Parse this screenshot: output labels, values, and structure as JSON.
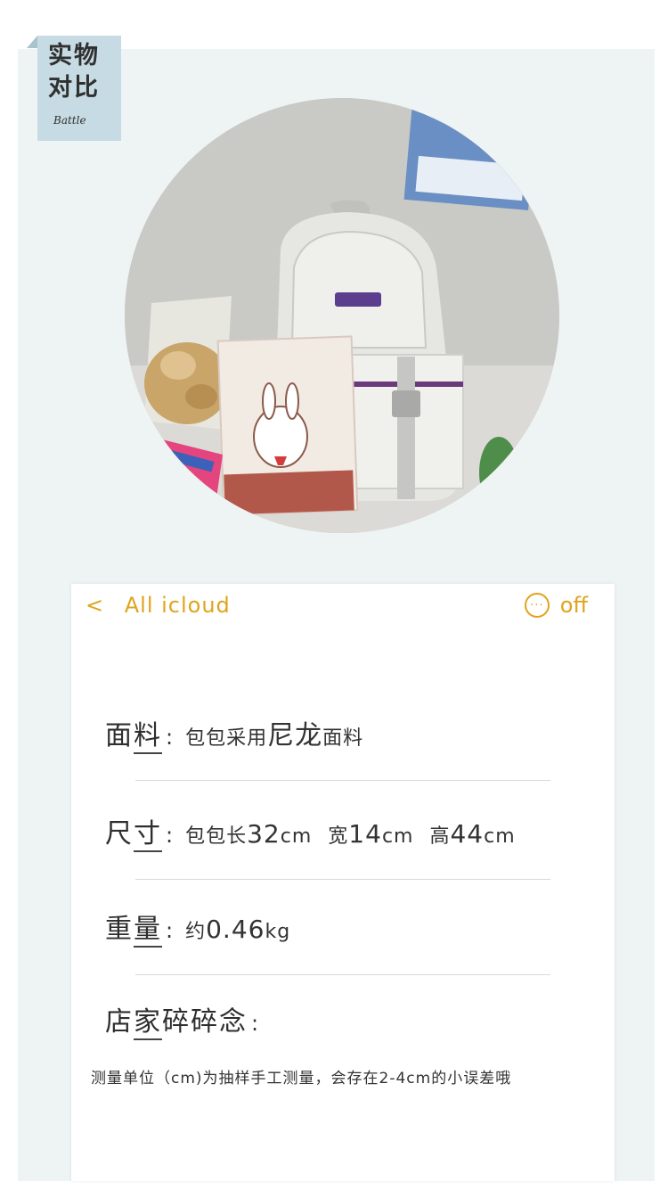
{
  "tag": {
    "line1": "实物",
    "line2": "对比",
    "sub": "Battle"
  },
  "photo": {
    "description_icon": "backpack-photo"
  },
  "card": {
    "back_arrow": "<",
    "back_label": "All icloud",
    "more_icon": "···",
    "more_label": "off"
  },
  "fabric": {
    "label_a": "面",
    "label_b": "料",
    "colon": ":",
    "value_prefix": "包包采用",
    "value_emph": "尼龙",
    "value_suffix": "面料"
  },
  "size": {
    "label_a": "尺",
    "label_b": "寸",
    "colon": ":",
    "l_prefix": "包包长",
    "l_value": "32",
    "l_unit": "cm",
    "w_prefix": "宽",
    "w_value": "14",
    "w_unit": "cm",
    "h_prefix": "高",
    "h_value": "44",
    "h_unit": "cm"
  },
  "weight": {
    "label_a": "重",
    "label_b": "量",
    "colon": ":",
    "prefix": "约",
    "value": "0.46",
    "unit": "kg"
  },
  "notes": {
    "label_a": "店",
    "label_b": "家",
    "label_c": "碎碎念",
    "colon": ":",
    "text": "测量单位（cm)为抽样手工测量，会存在2-4cm的小误差哦"
  },
  "colors": {
    "accent": "#e0a31c",
    "tag_bg": "#c6dbe3",
    "frame_bg": "#eef3f3"
  }
}
